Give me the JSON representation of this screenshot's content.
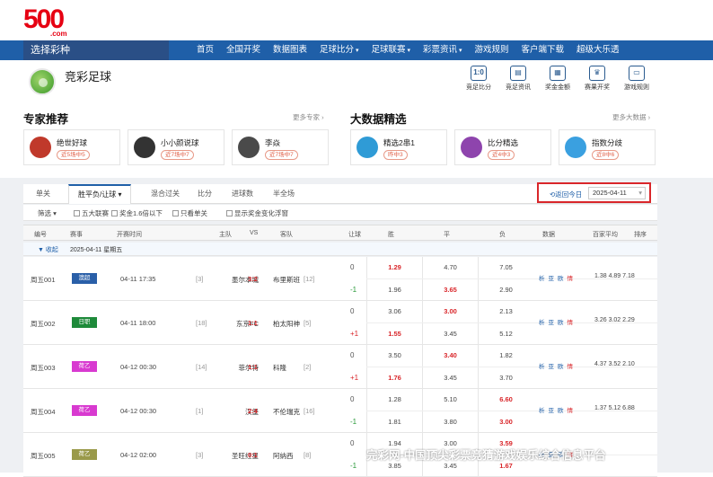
{
  "logo": {
    "number": "500",
    "domain": ".com"
  },
  "nav": {
    "selector_label": "选择彩种",
    "items": [
      "首页",
      "全国开奖",
      "数据图表",
      "足球比分",
      "足球联赛",
      "彩票资讯",
      "游戏规则",
      "客户端下载",
      "超级大乐透"
    ]
  },
  "header": {
    "title": "竞彩足球",
    "tools": [
      {
        "icon": "score-icon",
        "glyph": "1:0",
        "label": "竞足比分"
      },
      {
        "icon": "news-icon",
        "glyph": "▤",
        "label": "竞足资讯"
      },
      {
        "icon": "calculator-icon",
        "glyph": "▦",
        "label": "奖金金额"
      },
      {
        "icon": "trophy-icon",
        "glyph": "♛",
        "label": "赛果开奖"
      },
      {
        "icon": "rules-icon",
        "glyph": "▭",
        "label": "游戏规则"
      }
    ]
  },
  "experts": {
    "title": "专家推荐",
    "more": "更多专家 ›",
    "cards": [
      {
        "name": "绝世好球",
        "tag": "近5场中5",
        "avatar_color": "#c0392b"
      },
      {
        "name": "小小颜说球",
        "tag": "近7场中7",
        "avatar_color": "#333333"
      },
      {
        "name": "李焱",
        "tag": "近7场中7",
        "avatar_color": "#4a4a4a"
      }
    ]
  },
  "bigdata": {
    "title": "大数据精选",
    "more": "更多大数据 ›",
    "cards": [
      {
        "name": "精选2串1",
        "tag": "昨中3",
        "avatar_color": "#2f9bd6"
      },
      {
        "name": "比分精选",
        "tag": "近4中3",
        "avatar_color": "#8e44ad"
      },
      {
        "name": "指数分歧",
        "tag": "近8中6",
        "avatar_color": "#3aa0e0"
      }
    ]
  },
  "tabs": [
    "单关",
    "胜平负/让球 ▾",
    "混合过关",
    "比分",
    "进球数",
    "半全场"
  ],
  "date_filter": {
    "back_label": "⟲返回今日",
    "date": "2025-04-11"
  },
  "filters": [
    "筛选 ▾",
    "五大联赛",
    "奖金1.6倍以下",
    "只看单关",
    "显示奖金变化浮窗"
  ],
  "columns": [
    "编号",
    "赛事",
    "开赛时间",
    "主队",
    "VS",
    "客队",
    "让球",
    "胜",
    "平",
    "负",
    "数据",
    "百家平均",
    "排序"
  ],
  "day_header": {
    "toggle": "▼ 收起",
    "date": "2025-04-11 星期五"
  },
  "matches": [
    {
      "id": "周五001",
      "league": "澳超",
      "league_color": "#2a5fa8",
      "time": "04-11 17:35",
      "home_rank": "[3]",
      "home": "墨尔本城",
      "score": "3:2",
      "away": "布里斯班",
      "away_rank": "[12]",
      "hc1": "0",
      "hc2": "-1",
      "win1": "1.29",
      "draw1": "4.70",
      "lose1": "7.05",
      "win2": "1.96",
      "draw2": "3.65",
      "lose2": "2.90",
      "hl1": "win",
      "hl2": "draw",
      "avg": "1.38  4.89  7.18"
    },
    {
      "id": "周五002",
      "league": "日职",
      "league_color": "#1e8a3a",
      "time": "04-11 18:00",
      "home_rank": "[18]",
      "home": "东京FC",
      "score": "1:1",
      "away": "柏太阳神",
      "away_rank": "[5]",
      "hc1": "0",
      "hc2": "+1",
      "win1": "3.06",
      "draw1": "3.00",
      "lose1": "2.13",
      "win2": "1.55",
      "draw2": "3.45",
      "lose2": "5.12",
      "hl1": "draw",
      "hl2": "win",
      "avg": "3.26  3.02  2.29"
    },
    {
      "id": "周五003",
      "league": "荷乙",
      "league_color": "#d83ad0",
      "time": "04-12 00:30",
      "home_rank": "[14]",
      "home": "菲尔特",
      "score": "1:1",
      "away": "科隆",
      "away_rank": "[2]",
      "hc1": "0",
      "hc2": "+1",
      "win1": "3.50",
      "draw1": "3.40",
      "lose1": "1.82",
      "win2": "1.76",
      "draw2": "3.45",
      "lose2": "3.70",
      "hl1": "draw",
      "hl2": "win",
      "avg": "4.37  3.52  2.10"
    },
    {
      "id": "周五004",
      "league": "荷乙",
      "league_color": "#d83ad0",
      "time": "04-12 00:30",
      "home_rank": "[1]",
      "home": "汉堡",
      "score": "2:4",
      "away": "不伦瑞克",
      "away_rank": "[16]",
      "hc1": "0",
      "hc2": "-1",
      "win1": "1.28",
      "draw1": "5.10",
      "lose1": "6.60",
      "win2": "1.81",
      "draw2": "3.80",
      "lose2": "3.00",
      "hl1": "lose",
      "hl2": "lose",
      "avg": "1.37  5.12  6.88"
    },
    {
      "id": "周五005",
      "league": "荷乙",
      "league_color": "#9a9a4a",
      "time": "04-12 02:00",
      "home_rank": "[3]",
      "home": "圣旺红星",
      "score": "0:1",
      "away": "阿纳西",
      "away_rank": "[8]",
      "hc1": "0",
      "hc2": "-1",
      "win1": "1.94",
      "draw1": "3.00",
      "lose1": "3.59",
      "win2": "3.85",
      "draw2": "3.45",
      "lose2": "1.67",
      "hl1": "lose",
      "hl2": "lose",
      "avg": ""
    }
  ],
  "row_links": [
    "析",
    "亚",
    "欧",
    "情"
  ],
  "watermark": "完彩网-中国顶尖彩票竞猜游戏娱乐综合信息平台"
}
